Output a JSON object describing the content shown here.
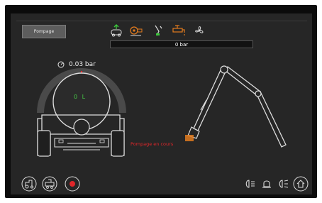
{
  "header": {
    "mode_button_label": "Pompage",
    "pressure_bar_label": "0 bar"
  },
  "top_icons": [
    "fill-tank-icon",
    "pump-icon",
    "arm-boom-icon",
    "faucet-icon",
    "fan-icon"
  ],
  "tank": {
    "pressure_value": "0.03 bar",
    "level_text": "0 L"
  },
  "status": {
    "message": "Pompage en cours"
  },
  "bottom_icons": {
    "left": [
      "tractor-icon",
      "settings-machine-icon",
      "record-icon"
    ],
    "right": [
      "headlight-icon",
      "beacon-icon",
      "worklight-icon",
      "home-icon"
    ]
  },
  "colors": {
    "accent_orange": "#e27b1e",
    "accent_green": "#3cc83c",
    "alert_red": "#e0262a",
    "record_red": "#e0262a"
  }
}
